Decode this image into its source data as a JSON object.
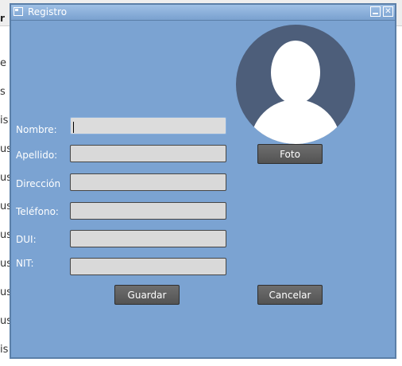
{
  "background_app": {
    "top_letter": "r",
    "fragments": [
      "e",
      "s",
      "is",
      "us",
      "us",
      "us",
      "us",
      "us",
      "us",
      "us",
      "is"
    ]
  },
  "window": {
    "title": "Registro",
    "minimize_glyph": "",
    "close_glyph": "✕"
  },
  "avatar": {
    "icon": "user-silhouette-icon"
  },
  "form": {
    "nombre_label": "Nombre:",
    "nombre_value": "",
    "apellido_label": "Apellido:",
    "apellido_value": "",
    "direccion_label": "Dirección",
    "direccion_value": "",
    "telefono_label": "Teléfono:",
    "telefono_value": "",
    "dui_label": "DUI:",
    "dui_value": "",
    "nit_label": "NIT:",
    "nit_value": ""
  },
  "buttons": {
    "foto": "Foto",
    "guardar": "Guardar",
    "cancelar": "Cancelar"
  },
  "colors": {
    "window_bg": "#7ba3d2",
    "avatar_bg": "#4d5e7a",
    "field_bg": "#d9d9d9",
    "button_bg": "#5e5e5e"
  }
}
